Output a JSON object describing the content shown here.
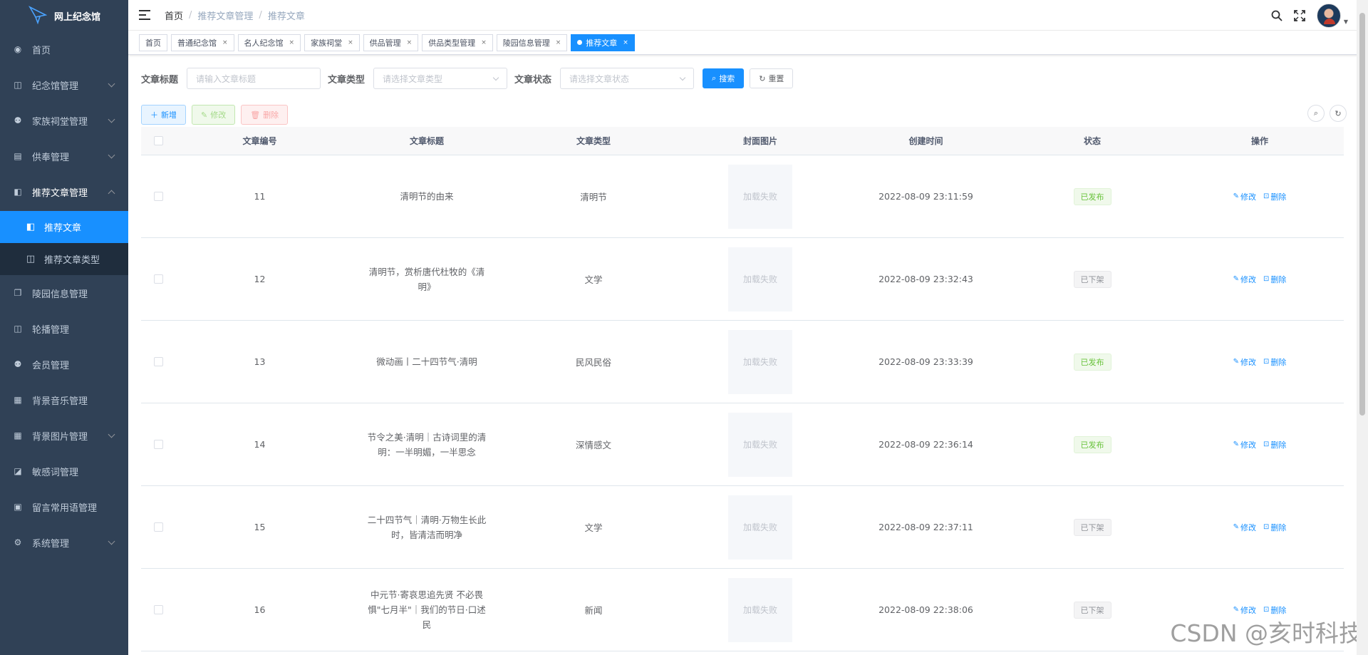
{
  "app": {
    "title": "网上纪念馆"
  },
  "sidebar": {
    "items": [
      {
        "label": "首页",
        "icon": "dashboard-icon",
        "glyph": "◉",
        "arrow": false
      },
      {
        "label": "纪念馆管理",
        "icon": "book-icon",
        "glyph": "◫",
        "arrow": true
      },
      {
        "label": "家族祠堂管理",
        "icon": "people-icon",
        "glyph": "⚉",
        "arrow": true
      },
      {
        "label": "供奉管理",
        "icon": "calendar-icon",
        "glyph": "▤",
        "arrow": true
      },
      {
        "label": "推荐文章管理",
        "icon": "article-icon",
        "glyph": "◧",
        "arrow": "up"
      },
      {
        "label": "推荐文章",
        "icon": "article-icon",
        "glyph": "◧",
        "sub": true,
        "active": true
      },
      {
        "label": "推荐文章类型",
        "icon": "book-icon",
        "glyph": "◫",
        "sub": true
      },
      {
        "label": "陵园信息管理",
        "icon": "copy-icon",
        "glyph": "❐",
        "arrow": false
      },
      {
        "label": "轮播管理",
        "icon": "book-icon",
        "glyph": "◫",
        "arrow": false
      },
      {
        "label": "会员管理",
        "icon": "people-icon",
        "glyph": "⚉",
        "arrow": false
      },
      {
        "label": "背景音乐管理",
        "icon": "grid-icon",
        "glyph": "▦",
        "arrow": false
      },
      {
        "label": "背景图片管理",
        "icon": "grid-icon",
        "glyph": "▦",
        "arrow": true
      },
      {
        "label": "敏感词管理",
        "icon": "chart-icon",
        "glyph": "◪",
        "arrow": false
      },
      {
        "label": "留言常用语管理",
        "icon": "message-icon",
        "glyph": "▣",
        "arrow": false
      },
      {
        "label": "系统管理",
        "icon": "gear-icon",
        "glyph": "⚙",
        "arrow": true
      }
    ]
  },
  "header": {
    "breadcrumb": [
      "首页",
      "推荐文章管理",
      "推荐文章"
    ]
  },
  "tags": [
    {
      "label": "首页",
      "closable": false
    },
    {
      "label": "普通纪念馆",
      "closable": true
    },
    {
      "label": "名人纪念馆",
      "closable": true
    },
    {
      "label": "家族祠堂",
      "closable": true
    },
    {
      "label": "供品管理",
      "closable": true
    },
    {
      "label": "供品类型管理",
      "closable": true
    },
    {
      "label": "陵园信息管理",
      "closable": true
    },
    {
      "label": "推荐文章",
      "closable": true,
      "active": true
    }
  ],
  "search": {
    "title_label": "文章标题",
    "title_placeholder": "请输入文章标题",
    "type_label": "文章类型",
    "type_placeholder": "请选择文章类型",
    "status_label": "文章状态",
    "status_placeholder": "请选择文章状态",
    "search_btn": "搜索",
    "reset_btn": "重置"
  },
  "toolbar": {
    "add": "新增",
    "edit": "修改",
    "delete": "删除"
  },
  "table": {
    "columns": [
      "文章编号",
      "文章标题",
      "文章类型",
      "封面图片",
      "创建时间",
      "状态",
      "操作"
    ],
    "img_fail_text": "加载失败",
    "edit_label": "修改",
    "delete_label": "删除",
    "rows": [
      {
        "id": "11",
        "title": "清明节的由来",
        "type": "清明节",
        "created": "2022-08-09 23:11:59",
        "status": "已发布",
        "published": true
      },
      {
        "id": "12",
        "title": "清明节，赏析唐代杜牧的《清明》",
        "type": "文学",
        "created": "2022-08-09 23:32:43",
        "status": "已下架",
        "published": false
      },
      {
        "id": "13",
        "title": "微动画丨二十四节气·清明",
        "type": "民风民俗",
        "created": "2022-08-09 23:33:39",
        "status": "已发布",
        "published": true
      },
      {
        "id": "14",
        "title": "节令之美·清明｜古诗词里的清明：一半明媚，一半思念",
        "type": "深情感文",
        "created": "2022-08-09 22:36:14",
        "status": "已发布",
        "published": true
      },
      {
        "id": "15",
        "title": "二十四节气｜清明·万物生长此时，皆清洁而明净",
        "type": "文学",
        "created": "2022-08-09 22:37:11",
        "status": "已下架",
        "published": false
      },
      {
        "id": "16",
        "title": "中元节·寄哀思追先贤 不必畏惧\"七月半\"｜我们的节日·口述民",
        "type": "新闻",
        "created": "2022-08-09 22:38:06",
        "status": "已下架",
        "published": false
      }
    ]
  },
  "watermark": "CSDN @亥时科技",
  "colors": {
    "sidebar_bg": "#304156",
    "primary": "#1890ff",
    "success": "#67c23a"
  }
}
